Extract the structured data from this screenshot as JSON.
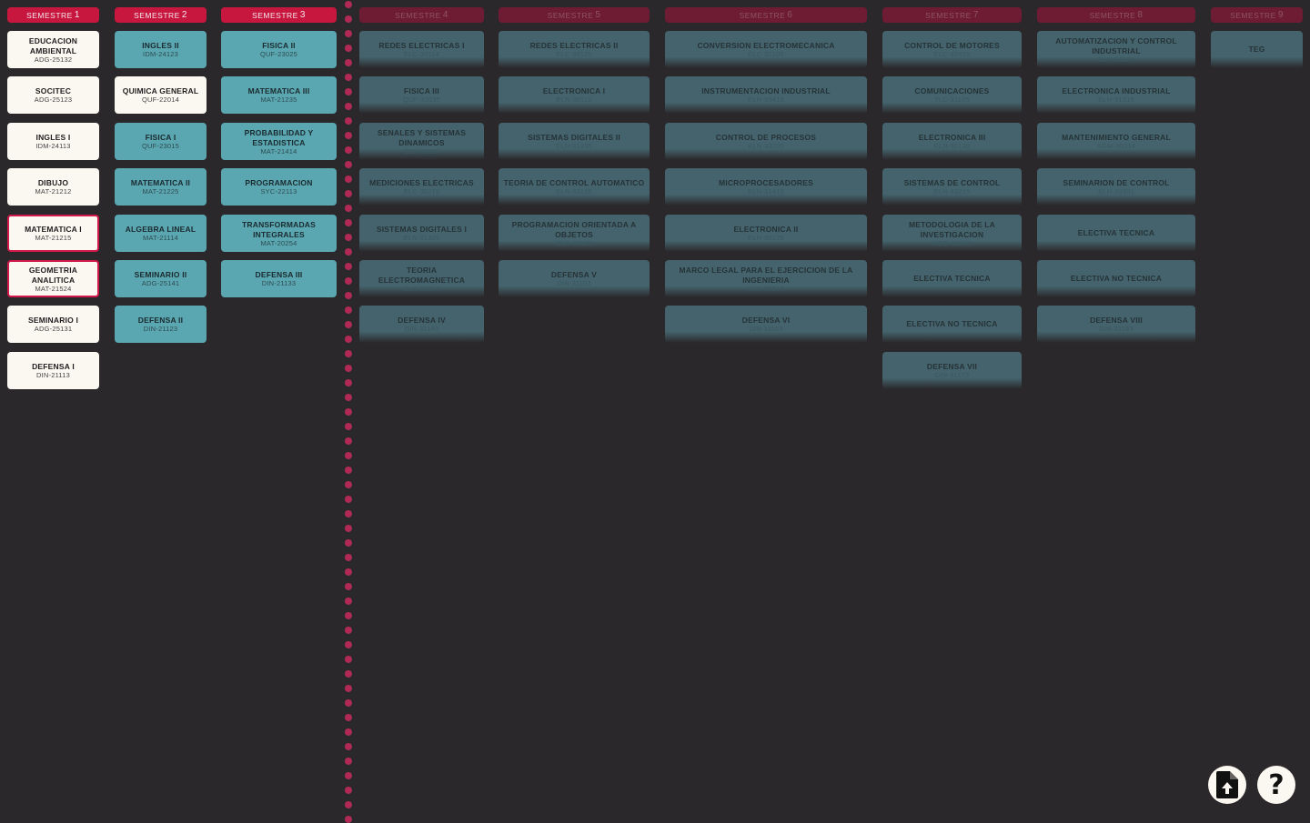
{
  "semesters": [
    {
      "label": "SEMESTRE",
      "num": "1",
      "courses": [
        {
          "name": "EDUCACION AMBIENTAL",
          "code": "ADG-25132"
        },
        {
          "name": "SOCITEC",
          "code": "ADG-25123"
        },
        {
          "name": "INGLES I",
          "code": "IDM-24113"
        },
        {
          "name": "DIBUJO",
          "code": "MAT-21212"
        },
        {
          "name": "MATEMATICA I",
          "code": "MAT-21215"
        },
        {
          "name": "GEOMETRIA ANALITICA",
          "code": "MAT-21524"
        },
        {
          "name": "SEMINARIO I",
          "code": "ADG-25131"
        },
        {
          "name": "DEFENSA I",
          "code": "DIN-21113"
        }
      ]
    },
    {
      "label": "SEMESTRE",
      "num": "2",
      "courses": [
        {
          "name": "INGLES II",
          "code": "IDM-24123"
        },
        {
          "name": "QUIMICA GENERAL",
          "code": "QUF-22014"
        },
        {
          "name": "FISICA I",
          "code": "QUF-23015"
        },
        {
          "name": "MATEMATICA II",
          "code": "MAT-21225"
        },
        {
          "name": "ALGEBRA LINEAL",
          "code": "MAT-21114"
        },
        {
          "name": "SEMINARIO II",
          "code": "ADG-25141"
        },
        {
          "name": "DEFENSA II",
          "code": "DIN-21123"
        }
      ]
    },
    {
      "label": "SEMESTRE",
      "num": "3",
      "courses": [
        {
          "name": "FISICA II",
          "code": "QUF-23025"
        },
        {
          "name": "MATEMATICA III",
          "code": "MAT-21235"
        },
        {
          "name": "PROBABILIDAD Y ESTADISTICA",
          "code": "MAT-21414"
        },
        {
          "name": "PROGRAMACION",
          "code": "SYC-22113"
        },
        {
          "name": "TRANSFORMADAS INTEGRALES",
          "code": "MAT-20254"
        },
        {
          "name": "DEFENSA III",
          "code": "DIN-21133"
        }
      ]
    },
    {
      "label": "SEMESTRE",
      "num": "4",
      "courses": [
        {
          "name": "REDES ELECTRICAS I",
          "code": "ELC-30114"
        },
        {
          "name": "FISICA III",
          "code": "QUF-33035"
        },
        {
          "name": "SENALES Y SISTEMAS DINAMICOS",
          "code": "ELN-33154"
        },
        {
          "name": "MEDICIONES ELECTRICAS",
          "code": "ELC-30215"
        },
        {
          "name": "SISTEMAS DIGITALES I",
          "code": "ELN-31325"
        },
        {
          "name": "TEORIA ELECTROMAGNETICA",
          "code": "ELN-30314"
        },
        {
          "name": "DEFENSA IV",
          "code": "DIN-31143"
        }
      ]
    },
    {
      "label": "SEMESTRE",
      "num": "5",
      "courses": [
        {
          "name": "REDES ELECTRICAS II",
          "code": "ELC-30125"
        },
        {
          "name": "ELECTRONICA I",
          "code": "ELN-30115"
        },
        {
          "name": "SISTEMAS DIGITALES II",
          "code": "ELN-31335"
        },
        {
          "name": "TEORIA DE CONTROL AUTOMATICO",
          "code": "ELN-33155"
        },
        {
          "name": "PROGRAMACION ORIENTADA A OBJETOS",
          "code": "ELN-34105"
        },
        {
          "name": "DEFENSA V",
          "code": "DIN-31153"
        }
      ]
    },
    {
      "label": "SEMESTRE",
      "num": "6",
      "courses": [
        {
          "name": "CONVERSION ELECTROMECANICA",
          "code": "ELC-32105"
        },
        {
          "name": "INSTRUMENTACION INDUSTRIAL",
          "code": "ELN-33415"
        },
        {
          "name": "CONTROL DE PROCESOS",
          "code": "ELN-33205"
        },
        {
          "name": "MICROPROCESADORES",
          "code": "ELN-31415"
        },
        {
          "name": "ELECTRONICA II",
          "code": "ELN-30125"
        },
        {
          "name": "MARCO LEGAL PARA EL EJERCICION DE LA INGENIERIA",
          "code": "CJU-37314"
        },
        {
          "name": "DEFENSA VI",
          "code": "DIN-31163"
        }
      ]
    },
    {
      "label": "SEMESTRE",
      "num": "7",
      "courses": [
        {
          "name": "CONTROL DE MOTORES",
          "code": "ELC-32415"
        },
        {
          "name": "COMUNICACIONES",
          "code": "TLC-31145"
        },
        {
          "name": "ELECTRONICA III",
          "code": "ELN-30135"
        },
        {
          "name": "SISTEMAS DE CONTROL",
          "code": "ELN-33215"
        },
        {
          "name": "METODOLOGIA DE LA INVESTIGACION",
          "code": "ADG-30214"
        },
        {
          "name": "ELECTIVA TECNICA",
          "code": ""
        },
        {
          "name": "ELECTIVA NO TECNICA",
          "code": ""
        },
        {
          "name": "DEFENSA VII",
          "code": "DIN-31173"
        }
      ]
    },
    {
      "label": "SEMESTRE",
      "num": "8",
      "courses": [
        {
          "name": "AUTOMATIZACION Y CONTROL INDUSTRIAL",
          "code": "ELN-33524"
        },
        {
          "name": "ELECTRONICA INDUSTRIAL",
          "code": "ELN-31315"
        },
        {
          "name": "MANTENIMIENTO GENERAL",
          "code": "AGM-30314"
        },
        {
          "name": "SEMINARION DE CONTROL",
          "code": "ELN-33301"
        },
        {
          "name": "ELECTIVA TECNICA",
          "code": ""
        },
        {
          "name": "ELECTIVA NO TECNICA",
          "code": ""
        },
        {
          "name": "DEFENSA VIII",
          "code": "DIN-31183"
        }
      ]
    },
    {
      "label": "SEMESTRE",
      "num": "9",
      "courses": [
        {
          "name": "TEG",
          "code": ""
        }
      ]
    }
  ],
  "actions": {
    "upload_icon": "file-upload-icon",
    "help_icon": "help-icon",
    "help_glyph": "?"
  },
  "colors": {
    "background": "#2a282b",
    "header_active": "#c8173f",
    "header_locked": "#6e1b34",
    "card_done": "#fbf8f1",
    "card_available": "#5ba7b1",
    "card_locked": "#44636c",
    "divider": "#b12a55"
  }
}
